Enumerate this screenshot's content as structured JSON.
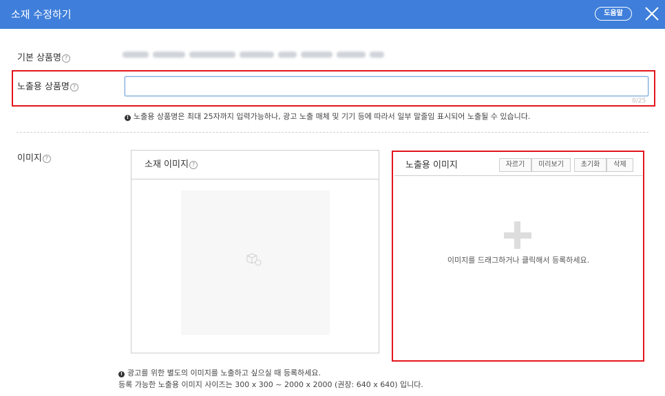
{
  "header": {
    "title": "소재 수정하기",
    "help_label": "도움말",
    "bg_color": "#3f7fdb"
  },
  "basic_name": {
    "label": "기본 상품명"
  },
  "exposure_name": {
    "label": "노출용 상품명",
    "value": "",
    "counter": "0/25",
    "note": "노출용 상품명은 최대 25자까지 입력가능하나, 광고 노출 매체 및 기기 등에 따라서 일부 말줄임 표시되어 노출될 수 있습니다."
  },
  "image": {
    "label": "이미지",
    "source_panel_title": "소재 이미지",
    "exposure_panel_title": "노출용 이미지",
    "tools": [
      "자르기",
      "미리보기",
      "초기화",
      "삭제"
    ],
    "drop_text": "이미지를 드래그하거나 클릭해서 등록하세요.",
    "note_line1": "광고를 위한 별도의 이미지를 노출하고 싶으실 때 등록하세요.",
    "note_line2": "등록 가능한 노출용 이미지 사이즈는 300 x 300 ~ 2000 x 2000 (권장: 640 x 640) 입니다."
  },
  "icons": [
    "close-icon",
    "help-question-icon",
    "image-placeholder-icon",
    "plus-icon",
    "info-bullet-icon"
  ],
  "highlight_color": "#e3141b"
}
